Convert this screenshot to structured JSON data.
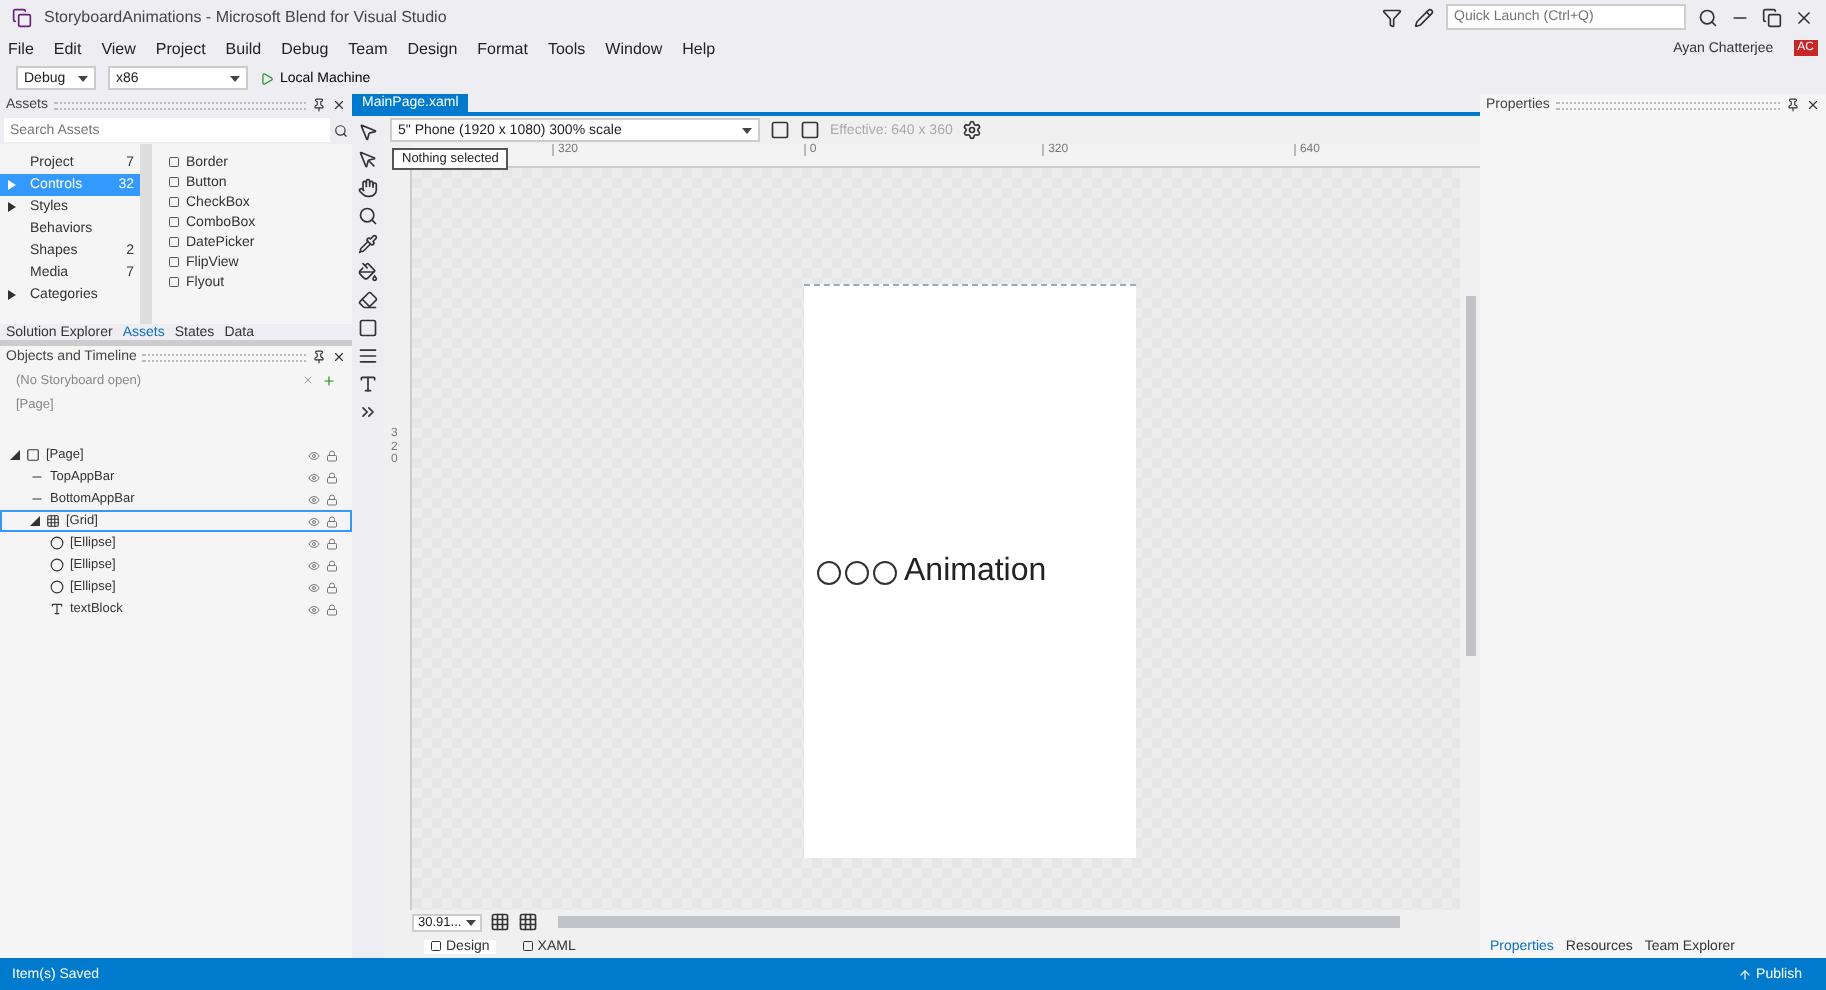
{
  "window": {
    "title": "StoryboardAnimations - Microsoft Blend for Visual Studio",
    "quick_launch": {
      "placeholder": "Quick Launch (Ctrl+Q)"
    },
    "user": "Ayan Chatterjee",
    "avatar": "AC"
  },
  "menu": [
    "File",
    "Edit",
    "View",
    "Project",
    "Build",
    "Debug",
    "Team",
    "Design",
    "Format",
    "Tools",
    "Window",
    "Help"
  ],
  "toolbar": {
    "configuration": "Debug",
    "platform": "x86",
    "run_target": "Local Machine"
  },
  "assets": {
    "title": "Assets",
    "search": {
      "placeholder": "Search Assets"
    },
    "categories": [
      {
        "label": "Project",
        "count": "7",
        "selected": false,
        "expandable": false
      },
      {
        "label": "Controls",
        "count": "32",
        "selected": true,
        "expandable": true
      },
      {
        "label": "Styles",
        "selected": false,
        "expandable": true
      },
      {
        "label": "Behaviors",
        "selected": false,
        "expandable": false
      },
      {
        "label": "Shapes",
        "count": "2",
        "selected": false,
        "expandable": false
      },
      {
        "label": "Media",
        "count": "7",
        "selected": false,
        "expandable": false
      },
      {
        "label": "Categories",
        "selected": false,
        "expandable": true
      }
    ],
    "items": [
      "Border",
      "Button",
      "CheckBox",
      "ComboBox",
      "DatePicker",
      "FlipView",
      "Flyout"
    ],
    "tabs": [
      {
        "label": "Solution Explorer",
        "selected": false
      },
      {
        "label": "Assets",
        "selected": true
      },
      {
        "label": "States",
        "selected": false
      },
      {
        "label": "Data",
        "selected": false
      }
    ]
  },
  "objects": {
    "title": "Objects and Timeline",
    "storyboard": "(No Storyboard open)",
    "root": "[Page]",
    "tree": [
      {
        "label": "[Page]",
        "kind": "page",
        "expanded": true,
        "selected": false,
        "children": [
          {
            "label": "TopAppBar",
            "kind": "appbar",
            "selected": false
          },
          {
            "label": "BottomAppBar",
            "kind": "appbar",
            "selected": false
          },
          {
            "label": "[Grid]",
            "kind": "grid",
            "expanded": true,
            "selected": true,
            "children": [
              {
                "label": "[Ellipse]",
                "kind": "ellipse",
                "selected": false
              },
              {
                "label": "[Ellipse]",
                "kind": "ellipse",
                "selected": false
              },
              {
                "label": "[Ellipse]",
                "kind": "ellipse",
                "selected": false
              },
              {
                "label": "textBlock",
                "kind": "text",
                "selected": false
              }
            ]
          }
        ]
      }
    ]
  },
  "document": {
    "tab": "MainPage.xaml",
    "device": "5\" Phone (1920 x 1080) 300% scale",
    "effective": "Effective: 640 x 360",
    "tooltip": "Nothing selected",
    "ruler": [
      "320",
      "0",
      "320",
      "640"
    ],
    "vertical_ruler": "320",
    "canvas_text": "Animation",
    "zoom": "30.91...",
    "views": [
      {
        "label": "Design",
        "selected": true
      },
      {
        "label": "XAML",
        "selected": false
      }
    ]
  },
  "properties": {
    "title": "Properties",
    "tabs": [
      {
        "label": "Properties",
        "selected": true
      },
      {
        "label": "Resources",
        "selected": false
      },
      {
        "label": "Team Explorer",
        "selected": false
      }
    ]
  },
  "status_bar": {
    "message": "Item(s) Saved",
    "publish": "Publish"
  }
}
